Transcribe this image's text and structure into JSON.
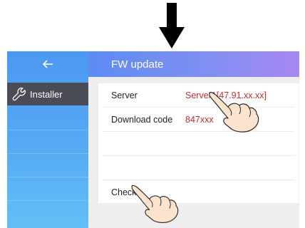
{
  "sidebar": {
    "back_icon": "left-arrow-icon",
    "installer_icon": "wrench-icon",
    "installer_label": "Installer"
  },
  "header": {
    "title": "FW update"
  },
  "settings": {
    "server_label": "Server",
    "server_value": "Server1[47.91.xx.xx]",
    "download_code_label": "Download code",
    "download_code_value": "847xxx",
    "check_label": "Check"
  },
  "colors": {
    "value_text": "#d32a2a",
    "sidebar_selected": "#4a4d55",
    "header_gradient_start": "#5c8cf3",
    "header_gradient_end": "#a888f2"
  }
}
